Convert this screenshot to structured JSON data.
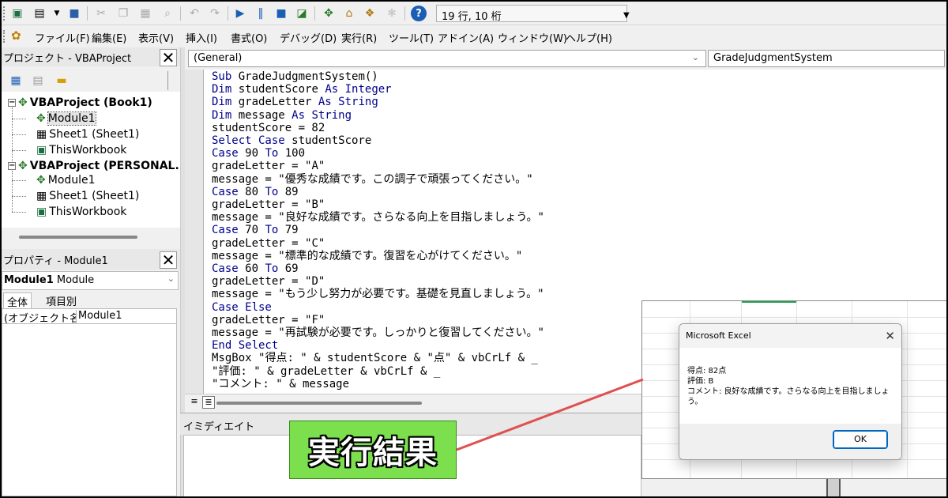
{
  "toolbar": {
    "status": "19 行, 10 桁",
    "icons": [
      "excel-icon",
      "insert-form-icon",
      "save-icon",
      "cut-icon",
      "copy-icon",
      "paste-icon",
      "find-icon",
      "undo-icon",
      "redo-icon",
      "run-icon",
      "pause-icon",
      "stop-icon",
      "design-mode-icon",
      "project-explorer-icon",
      "properties-icon",
      "object-browser-icon",
      "toolbox-icon",
      "help-icon"
    ]
  },
  "menubar": {
    "items": [
      "ファイル(F)",
      "編集(E)",
      "表示(V)",
      "挿入(I)",
      "書式(O)",
      "デバッグ(D)",
      "実行(R)",
      "ツール(T)",
      "アドイン(A)",
      "ウィンドウ(W)",
      "ヘルプ(H)"
    ]
  },
  "project": {
    "title": "プロジェクト - VBAProject",
    "tree": [
      {
        "label": "VBAProject (Book1)"
      },
      {
        "label": "Module1"
      },
      {
        "label": "Sheet1 (Sheet1)"
      },
      {
        "label": "ThisWorkbook"
      },
      {
        "label": "VBAProject (PERSONAL.)"
      },
      {
        "label": "Module1"
      },
      {
        "label": "Sheet1 (Sheet1)"
      },
      {
        "label": "ThisWorkbook"
      }
    ]
  },
  "properties": {
    "title": "プロパティ - Module1",
    "object_name": "Module1",
    "object_type": "Module",
    "tabs": [
      "全体",
      "項目別"
    ],
    "rows": [
      {
        "key": "(オブジェクト名)",
        "value": "Module1"
      }
    ]
  },
  "code_window": {
    "object_combo": "(General)",
    "proc_combo": "GradeJudgmentSystem",
    "lines": [
      "Sub GradeJudgmentSystem()",
      "Dim studentScore As Integer",
      "Dim gradeLetter As String",
      "Dim message As String",
      "studentScore = 82",
      "Select Case studentScore",
      "Case 90 To 100",
      "gradeLetter = \"A\"",
      "message = \"優秀な成績です。この調子で頑張ってください。\"",
      "Case 80 To 89",
      "gradeLetter = \"B\"",
      "message = \"良好な成績です。さらなる向上を目指しましょう。\"",
      "Case 70 To 79",
      "gradeLetter = \"C\"",
      "message = \"標準的な成績です。復習を心がけてください。\"",
      "Case 60 To 69",
      "gradeLetter = \"D\"",
      "message = \"もう少し努力が必要です。基礎を見直しましょう。\"",
      "Case Else",
      "gradeLetter = \"F\"",
      "message = \"再試験が必要です。しっかりと復習してください。\"",
      "End Select",
      "MsgBox \"得点: \" & studentScore & \"点\" & vbCrLf & _",
      "\"評価: \" & gradeLetter & vbCrLf & _",
      "\"コメント: \" & message"
    ]
  },
  "immediate": {
    "title": "イミディエイト"
  },
  "msgbox": {
    "title": "Microsoft Excel",
    "lines": [
      "得点: 82点",
      "評価: B",
      "コメント: 良好な成績です。さらなる向上を目指しましょう。"
    ],
    "ok_label": "OK"
  },
  "callout": {
    "label": "実行結果",
    "fill_color": "#7ce04e",
    "line_color": "#e05050"
  },
  "colors": {
    "keyword": "#00008b",
    "accent": "#0067c0"
  }
}
